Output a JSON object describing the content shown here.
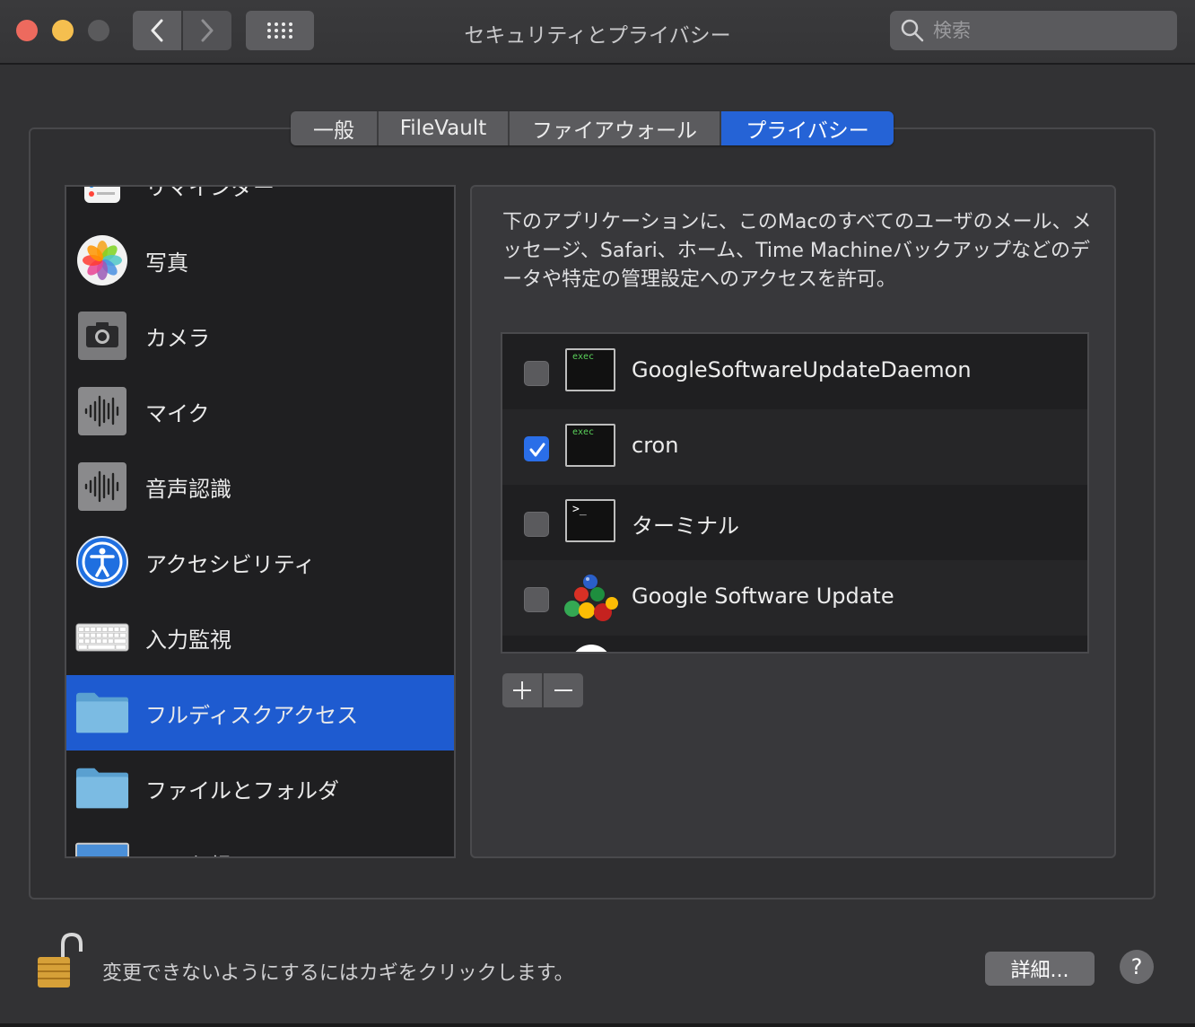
{
  "window": {
    "title": "セキュリティとプライバシー",
    "search_placeholder": "検索"
  },
  "tabs": [
    {
      "label": "一般",
      "active": false
    },
    {
      "label": "FileVault",
      "active": false
    },
    {
      "label": "ファイアウォール",
      "active": false
    },
    {
      "label": "プライバシー",
      "active": true
    }
  ],
  "sidebar": {
    "items": [
      {
        "label": "リマインダー",
        "icon": "reminders-icon"
      },
      {
        "label": "写真",
        "icon": "photos-icon"
      },
      {
        "label": "カメラ",
        "icon": "camera-icon"
      },
      {
        "label": "マイク",
        "icon": "microphone-icon"
      },
      {
        "label": "音声認識",
        "icon": "speech-recognition-icon"
      },
      {
        "label": "アクセシビリティ",
        "icon": "accessibility-icon"
      },
      {
        "label": "入力監視",
        "icon": "keyboard-icon"
      },
      {
        "label": "フルディスクアクセス",
        "icon": "folder-icon",
        "selected": true
      },
      {
        "label": "ファイルとフォルダ",
        "icon": "folder-icon"
      },
      {
        "label": "画面収録",
        "icon": "screen-recording-icon"
      }
    ]
  },
  "main": {
    "description": "下のアプリケーションに、このMacのすべてのユーザのメール、メッセージ、Safari、ホーム、Time Machineバックアップなどのデータや特定の管理設定へのアクセスを許可。",
    "apps": [
      {
        "name": "GoogleSoftwareUpdateDaemon",
        "checked": false,
        "icon": "exec-icon",
        "icon_text": "exec"
      },
      {
        "name": "cron",
        "checked": true,
        "icon": "exec-icon",
        "icon_text": "exec"
      },
      {
        "name": "ターミナル",
        "checked": false,
        "icon": "terminal-icon",
        "icon_text": ">_"
      },
      {
        "name": "Google Software Update",
        "checked": false,
        "icon": "google-software-update-icon"
      }
    ],
    "add_label": "+",
    "remove_label": "−"
  },
  "footer": {
    "lock_text": "変更できないようにするにはカギをクリックします。",
    "details_label": "詳細...",
    "help_label": "?"
  },
  "colors": {
    "accent": "#1e5bd0",
    "tab_active": "#2563d6",
    "checkbox_on": "#2a6ee8"
  }
}
